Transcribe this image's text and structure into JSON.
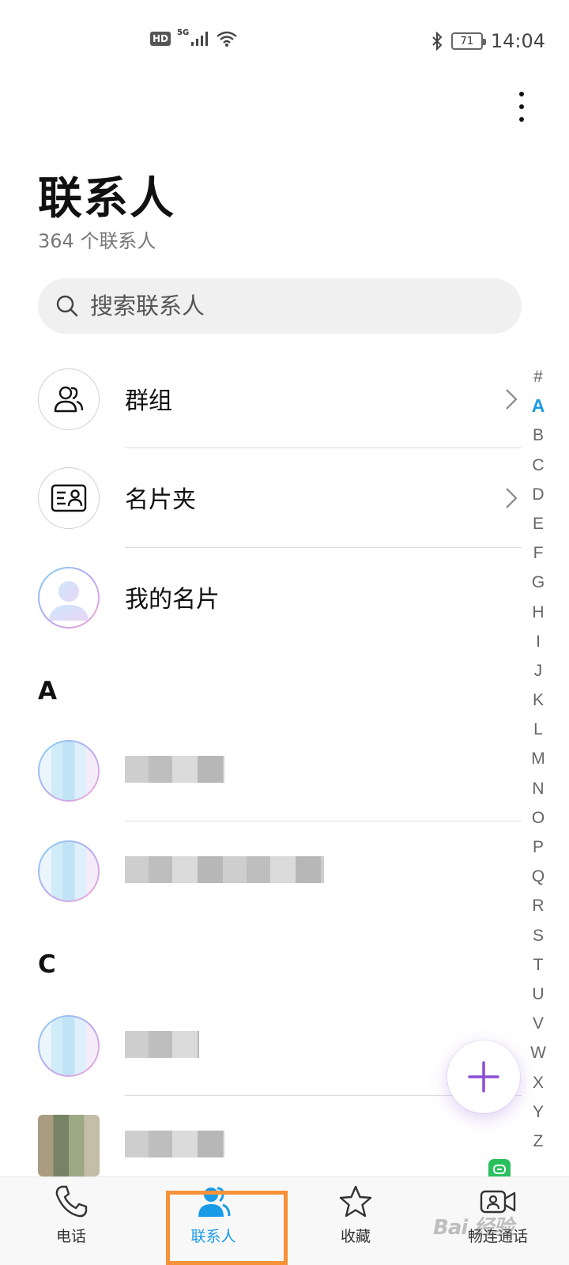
{
  "status_bar": {
    "hd": "HD",
    "network": "5G",
    "battery": "71",
    "time": "14:04"
  },
  "header": {
    "title": "联系人",
    "count": "364 个联系人"
  },
  "search": {
    "placeholder": "搜索联系人"
  },
  "shortcuts": [
    {
      "label": "群组",
      "icon": "group-icon"
    },
    {
      "label": "名片夹",
      "icon": "business-card-icon"
    },
    {
      "label": "我的名片",
      "icon": "my-card-avatar"
    }
  ],
  "sections": [
    {
      "letter": "A"
    },
    {
      "letter": "C"
    }
  ],
  "alpha_index": [
    "#",
    "A",
    "B",
    "C",
    "D",
    "E",
    "F",
    "G",
    "H",
    "I",
    "J",
    "K",
    "L",
    "M",
    "N",
    "O",
    "P",
    "Q",
    "R",
    "S",
    "T",
    "U",
    "V",
    "W",
    "X",
    "Y",
    "Z"
  ],
  "alpha_active": "A",
  "bottom_nav": [
    {
      "label": "电话",
      "icon": "phone-icon"
    },
    {
      "label": "联系人",
      "icon": "contacts-icon"
    },
    {
      "label": "收藏",
      "icon": "star-icon"
    },
    {
      "label": "畅连通话",
      "icon": "video-call-icon"
    }
  ],
  "watermark": "Bai 经验",
  "colors": {
    "accent": "#1a9be8",
    "highlight": "#f7913a",
    "fab_plus": "#8a4fd6"
  }
}
